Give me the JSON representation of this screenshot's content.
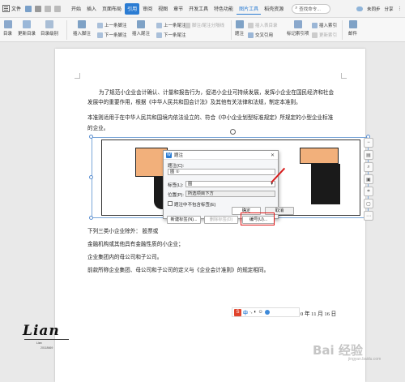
{
  "menubar": {
    "file": "文件",
    "tabs": [
      "开始",
      "插入",
      "页面布局",
      "引用",
      "审阅",
      "视图",
      "章节",
      "开发工具",
      "特色功能",
      "图片工具",
      "稻壳资源"
    ],
    "active_tab_index": 3,
    "search": "查找命令...",
    "cloud_status": "未同步",
    "share": "分享"
  },
  "ribbon": {
    "directory": "目录",
    "update_directory": "更新目录",
    "directory_level": "目录级别",
    "insert_footnote": "插入脚注",
    "prev_footnote": "上一条脚注",
    "next_footnote": "下一条脚注",
    "insert_endnote": "插入尾注",
    "footnote_endnote_separator": "脚注/尾注分隔线",
    "prev_endnote": "上一条尾注",
    "next_endnote": "下一条尾注",
    "caption": "题注",
    "insert_table_of_figures": "插入表目录",
    "cross_reference": "交叉引用",
    "mark_index_entry": "标记索引项",
    "insert_index": "插入索引",
    "update_index": "更新索引",
    "mail": "邮件"
  },
  "document": {
    "p1_line1": "为了规范小企业会计确认、计量和报告行为，促进小企业可持续发展，发挥小企业在国民经济和社会",
    "p1_line2": "发展中的重要作用，根据《中华人民共和国会计法》及其他有关法律和法规，制定本准则。",
    "p2_line1": "本准则适用于在中华人民共和国境内依法设立的、符合《中小企业划型标准规定》所规定的小型企业标准",
    "p2_line2": "的企业。",
    "p3_line1": "下列三类小企业除外：  股票或",
    "p3_line2": "金融机构或其他具有金融性质的小企业；",
    "p3_line3": "企业集团内的母公司和子公司。",
    "p4": "前款所称企业集团、母公司和子公司的定义与《企业会计准则》的规定相同。",
    "date_tail": "0 年 11 月 16 日"
  },
  "dialog": {
    "title": "题注",
    "caption_label": "题注(C):",
    "caption_value": "图 ①",
    "label_label": "标签(L):",
    "label_value": "图",
    "position_label": "位置(P):",
    "position_value": "所选项目下方",
    "exclude_label_text": "题注中不包含标签(E)",
    "new_label_btn": "新建标签(N)...",
    "delete_label_btn": "删除标签(D)",
    "numbering_btn": "编号(U)...",
    "ok_btn": "确定",
    "cancel_btn": "取消",
    "close": "✕"
  },
  "ime": {
    "lang": "中",
    "symbols": "·, ◐ ☺"
  },
  "signature": {
    "name": "Lian",
    "sub": "Lian",
    "number": "20118669"
  },
  "watermark": {
    "text": "Bai 经验",
    "sub": "jingyan.baidu.com"
  },
  "colors": {
    "accent": "#2b7cd3",
    "highlight": "#e01818"
  }
}
